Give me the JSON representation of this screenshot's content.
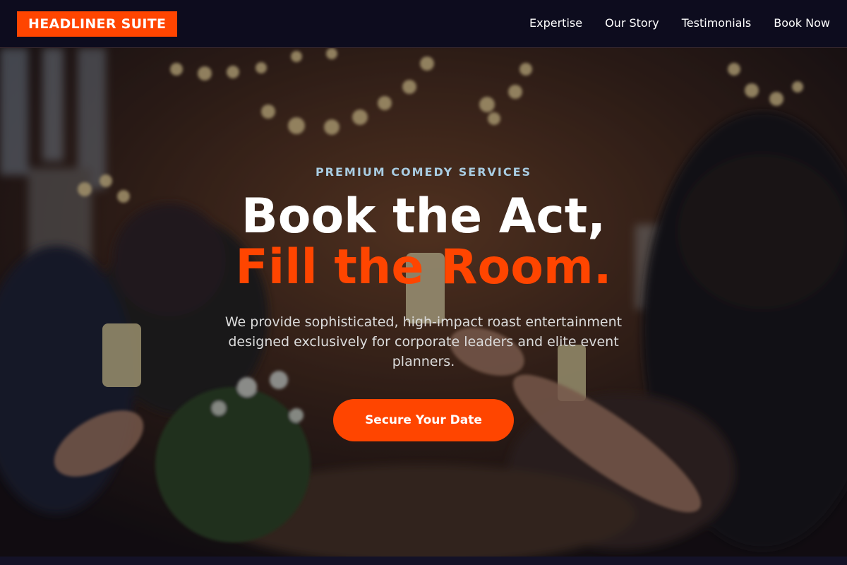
{
  "brand": {
    "logo_text": "HEADLINER SUITE",
    "accent_color": "#ff4500"
  },
  "nav": {
    "items": [
      {
        "label": "Expertise"
      },
      {
        "label": "Our Story"
      },
      {
        "label": "Testimonials"
      },
      {
        "label": "Book Now"
      }
    ]
  },
  "hero": {
    "eyebrow": "PREMIUM COMEDY SERVICES",
    "headline_line1": "Book the Act,",
    "headline_line2": "Fill the Room.",
    "lead": "We provide sophisticated, high-impact roast entertainment designed exclusively for corporate leaders and elite event planners.",
    "cta_label": "Secure Your Date",
    "background": "banquet-celebration-photo"
  }
}
